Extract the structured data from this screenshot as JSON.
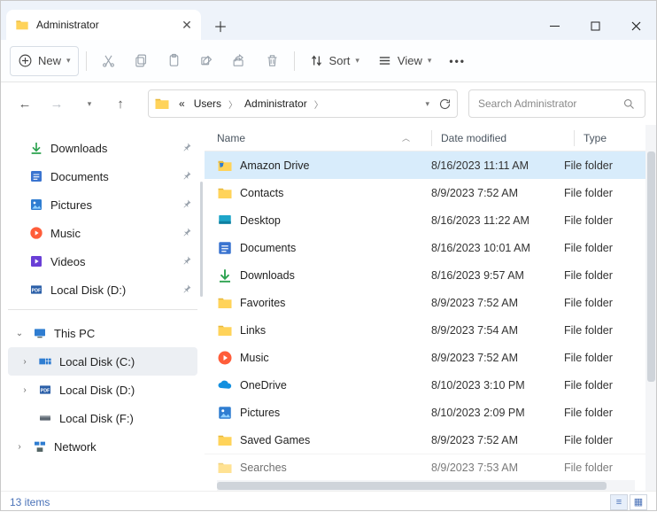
{
  "title": "Administrator",
  "toolbar": {
    "new": "New",
    "sort": "Sort",
    "view": "View"
  },
  "breadcrumb": {
    "seg0": "«",
    "seg1": "Users",
    "seg2": "Administrator"
  },
  "search": {
    "placeholder": "Search Administrator"
  },
  "sidebar": {
    "qa": [
      {
        "label": "Downloads",
        "icon": "download"
      },
      {
        "label": "Documents",
        "icon": "doc"
      },
      {
        "label": "Pictures",
        "icon": "pictures"
      },
      {
        "label": "Music",
        "icon": "music"
      },
      {
        "label": "Videos",
        "icon": "videos"
      },
      {
        "label": "Local Disk (D:)",
        "icon": "diskpdf"
      }
    ],
    "tree": [
      {
        "label": "This PC",
        "icon": "pc",
        "expanded": true,
        "depth": 0
      },
      {
        "label": "Local Disk (C:)",
        "icon": "disk-c",
        "depth": 1,
        "selected": true
      },
      {
        "label": "Local Disk (D:)",
        "icon": "diskpdf",
        "depth": 1
      },
      {
        "label": "Local Disk (F:)",
        "icon": "disk",
        "depth": 1
      },
      {
        "label": "Network",
        "icon": "network",
        "depth": 0
      }
    ]
  },
  "columns": {
    "name": "Name",
    "date": "Date modified",
    "type": "Type"
  },
  "rows": [
    {
      "name": "Amazon Drive",
      "date": "8/16/2023 11:11 AM",
      "type": "File folder",
      "icon": "amazon",
      "selected": true
    },
    {
      "name": "Contacts",
      "date": "8/9/2023 7:52 AM",
      "type": "File folder",
      "icon": "folder"
    },
    {
      "name": "Desktop",
      "date": "8/16/2023 11:22 AM",
      "type": "File folder",
      "icon": "desktop"
    },
    {
      "name": "Documents",
      "date": "8/16/2023 10:01 AM",
      "type": "File folder",
      "icon": "doc"
    },
    {
      "name": "Downloads",
      "date": "8/16/2023 9:57 AM",
      "type": "File folder",
      "icon": "download"
    },
    {
      "name": "Favorites",
      "date": "8/9/2023 7:52 AM",
      "type": "File folder",
      "icon": "folder"
    },
    {
      "name": "Links",
      "date": "8/9/2023 7:54 AM",
      "type": "File folder",
      "icon": "folder"
    },
    {
      "name": "Music",
      "date": "8/9/2023 7:52 AM",
      "type": "File folder",
      "icon": "music"
    },
    {
      "name": "OneDrive",
      "date": "8/10/2023 3:10 PM",
      "type": "File folder",
      "icon": "onedrive"
    },
    {
      "name": "Pictures",
      "date": "8/10/2023 2:09 PM",
      "type": "File folder",
      "icon": "pictures"
    },
    {
      "name": "Saved Games",
      "date": "8/9/2023 7:52 AM",
      "type": "File folder",
      "icon": "folder"
    },
    {
      "name": "Searches",
      "date": "8/9/2023 7:53 AM",
      "type": "File folder",
      "icon": "folder",
      "cut": true
    }
  ],
  "status": {
    "count": "13 items"
  }
}
